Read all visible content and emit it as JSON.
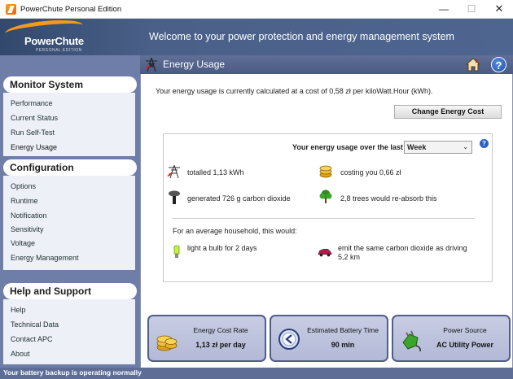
{
  "window": {
    "title": "PowerChute Personal Edition",
    "minimize": "—",
    "maximize": "☐",
    "close": "✕"
  },
  "banner": {
    "logo_text": "PowerChute",
    "logo_sub": "PERSONAL EDITION",
    "headline": "Welcome to your power protection and energy management system"
  },
  "sidebar": {
    "monitor": {
      "title": "Monitor System",
      "items": [
        "Performance",
        "Current Status",
        "Run Self-Test",
        "Energy Usage"
      ]
    },
    "config": {
      "title": "Configuration",
      "items": [
        "Options",
        "Runtime",
        "Notification",
        "Sensitivity",
        "Voltage",
        "Energy Management"
      ]
    },
    "help": {
      "title": "Help and Support",
      "items": [
        "Help",
        "Technical Data",
        "Contact APC",
        "About"
      ]
    }
  },
  "page": {
    "title": "Energy Usage",
    "help_glyph": "?"
  },
  "content": {
    "cost_line": "Your energy usage is currently calculated at a cost of 0,58 zł per kiloWatt.Hour (kWh).",
    "change_button": "Change Energy Cost",
    "over_label": "Your energy usage over the last",
    "period": "Week",
    "panel_help": "?",
    "stats": {
      "totalled": "totalled 1,13 kWh",
      "costing": "costing you  0,66 zł",
      "generated": "generated 726 g carbon dioxide",
      "trees": "2,8 trees would re-absorb this"
    },
    "avg_label": "For an average household, this would:",
    "bulb": "light a bulb for 2 days",
    "car_line1": "emit the same carbon dioxide as driving",
    "car_line2": "5,2 km"
  },
  "cards": [
    {
      "label": "Energy Cost Rate",
      "value": "1,13 zł per day"
    },
    {
      "label": "Estimated Battery Time",
      "value": "90 min"
    },
    {
      "label": "Power Source",
      "value": "AC Utility Power"
    }
  ],
  "status": {
    "text": "Your battery backup is operating normally"
  },
  "colors": {
    "banner": "#4a6088",
    "sidebar": "#6f7ea8",
    "accent": "#f39a1e"
  }
}
